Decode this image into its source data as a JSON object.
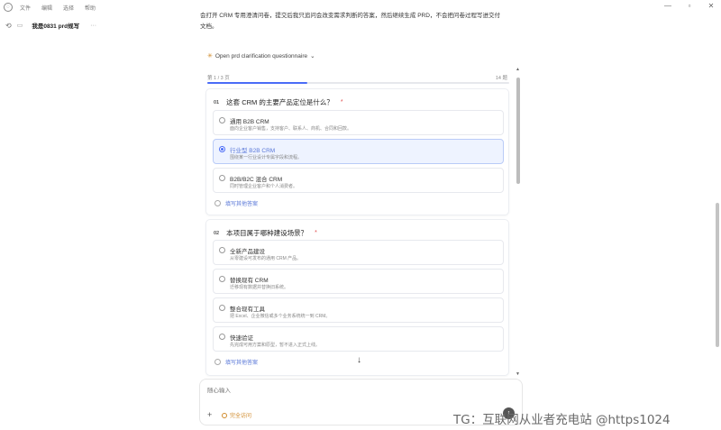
{
  "titlebar": {
    "menu": [
      "文件",
      "编辑",
      "选择",
      "帮助"
    ]
  },
  "sidebar": {
    "item_title": "我是0831 prd规写",
    "item_more": "···"
  },
  "intro": {
    "faded_line": "",
    "line1": "会打开 CRM 专用澄清问卷，提交后我只追问会改变需求判断的答案，然后继续生成 PRD，不会把问卷过程写进交付",
    "line2": "文档。"
  },
  "toggle": {
    "label": "Open prd clarification questionnaire"
  },
  "panel": {
    "page_indicator": "第 1 / 3 页",
    "question_count": "14 题",
    "progress": 0.33,
    "q1": {
      "num": "01",
      "text": "这套 CRM 的主要产品定位是什么？",
      "star": "*",
      "options": [
        {
          "label": "通用 B2B CRM",
          "desc": "面向企业客户销售，支持客户、联系人、商机、合同和回款。",
          "selected": false
        },
        {
          "label": "行业型 B2B CRM",
          "desc": "围绕某一行业设计专属字段和流程。",
          "selected": true
        },
        {
          "label": "B2B/B2C 混合 CRM",
          "desc": "同时管理企业客户和个人消费者。",
          "selected": false
        }
      ],
      "other": "填写其他答案"
    },
    "q2": {
      "num": "02",
      "text": "本项目属于哪种建设场景？",
      "star": "*",
      "options": [
        {
          "label": "全新产品建设",
          "desc": "从零建设可发布的通用 CRM 产品。"
        },
        {
          "label": "替换现有 CRM",
          "desc": "迁移现有数据并替换旧系统。"
        },
        {
          "label": "整合现有工具",
          "desc": "把 Excel、企业微信或多个业务系统统一到 CRM。"
        },
        {
          "label": "快速验证",
          "desc": "先完成可用方案和原型，暂不进入正式上线。"
        }
      ],
      "other": "填写其他答案"
    }
  },
  "composer": {
    "placeholder": "随心输入",
    "plus": "+",
    "mode_label": "完全访问",
    "send": "↑"
  },
  "watermark": "TG：互联网从业者充电站 @https1024"
}
